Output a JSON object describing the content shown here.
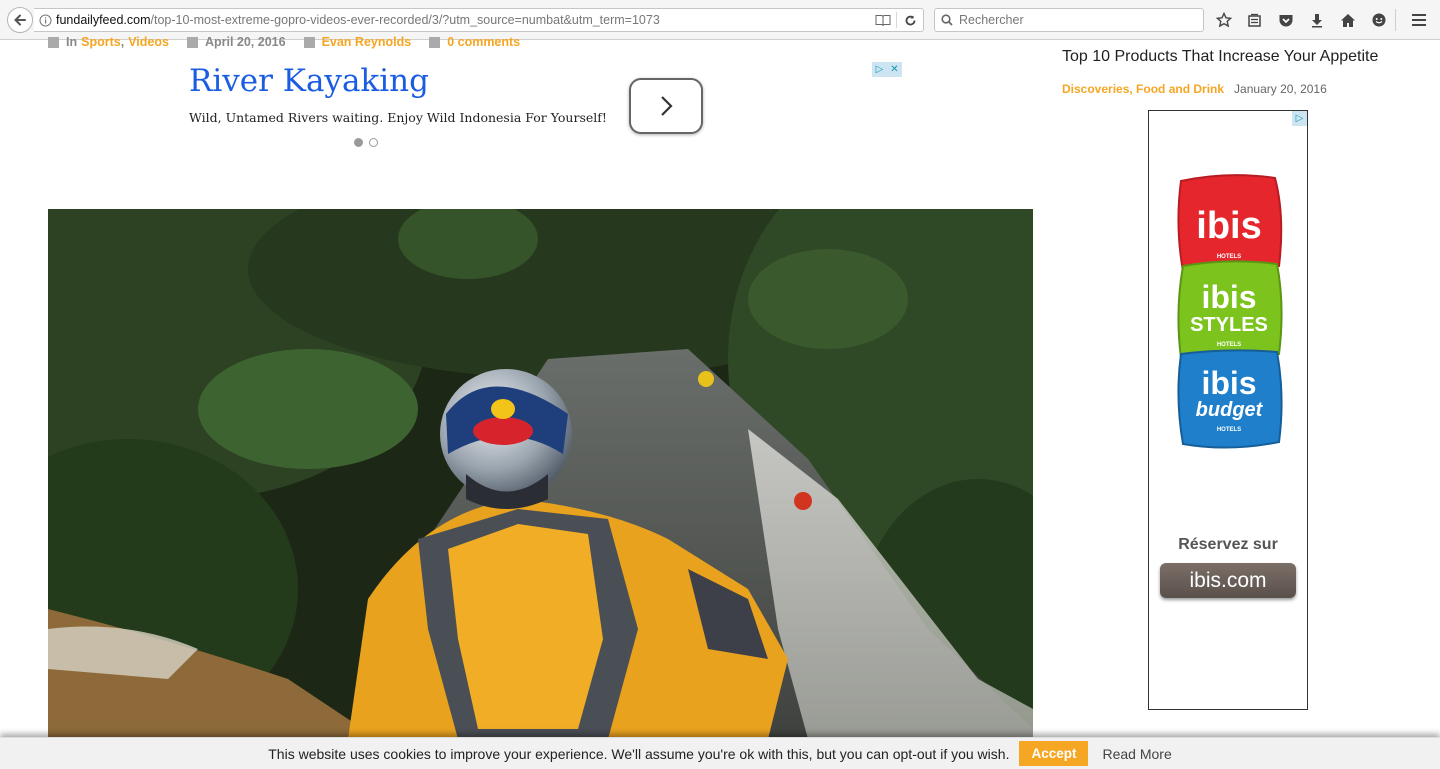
{
  "browser": {
    "url_host": "fundailyfeed.com",
    "url_path": "/top-10-most-extreme-gopro-videos-ever-recorded/3/?utm_source=numbat&utm_term=1073",
    "search_placeholder": "Rechercher",
    "toolbar_icons": [
      "star-icon",
      "library-icon",
      "pocket-icon",
      "download-icon",
      "home-icon",
      "chat-icon"
    ]
  },
  "post_meta": {
    "in_label": "In",
    "categories": [
      "Sports",
      "Videos"
    ],
    "separator": ",",
    "date": "April 20, 2016",
    "author": "Evan Reynolds",
    "comments": "0 comments"
  },
  "top_ad": {
    "title": "River Kayaking",
    "description": "Wild, Untamed Rivers waiting. Enjoy Wild Indonesia For Yourself!",
    "slide_count": 2,
    "active_slide": 1
  },
  "sidebar": {
    "post_title": "Top 10 Products That Increase Your Appetite",
    "post_categories": "Discoveries, Food and Drink",
    "post_date": "January 20, 2016"
  },
  "side_ad": {
    "pillows": [
      {
        "brand": "ibis",
        "sub": "HOTELS",
        "color": "#e5262d"
      },
      {
        "brand": "ibis",
        "style": "STYLES",
        "sub": "HOTELS",
        "color": "#7cc31e"
      },
      {
        "brand": "ibis",
        "style": "budget",
        "sub": "HOTELS",
        "color": "#1f7fcb"
      }
    ],
    "reserve_text": "Réservez sur",
    "button_text": "ibis.com"
  },
  "cookie_bar": {
    "text": "This website uses cookies to improve your experience. We'll assume you're ok with this, but you can opt-out if you wish.",
    "accept": "Accept",
    "read_more": "Read More"
  },
  "colors": {
    "accent": "#f5a623",
    "ad_title": "#1a5de3"
  }
}
